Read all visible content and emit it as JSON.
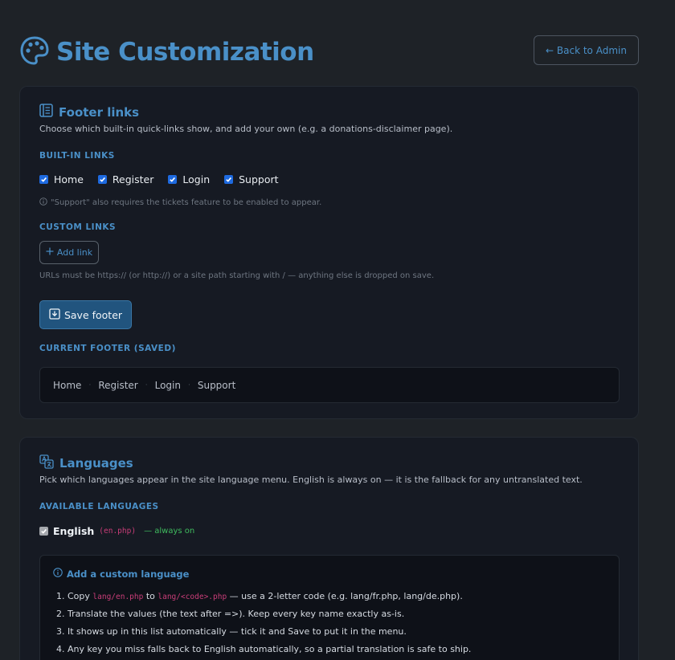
{
  "page": {
    "title": "Site Customization",
    "back_label": "← Back to Admin"
  },
  "footer_section": {
    "title": "Footer links",
    "description": "Choose which built-in quick-links show, and add your own (e.g. a donations-disclaimer page).",
    "builtin_label": "BUILT-IN LINKS",
    "builtin_links": [
      {
        "label": "Home",
        "checked": true
      },
      {
        "label": "Register",
        "checked": true
      },
      {
        "label": "Login",
        "checked": true
      },
      {
        "label": "Support",
        "checked": true
      }
    ],
    "support_note": "\"Support\" also requires the tickets feature to be enabled to appear.",
    "custom_label": "CUSTOM LINKS",
    "add_link_label": "Add link",
    "url_note": "URLs must be https:// (or http://) or a site path starting with / — anything else is dropped on save.",
    "save_label": "Save footer",
    "current_label": "CURRENT FOOTER (SAVED)",
    "current_links": [
      "Home",
      "Register",
      "Login",
      "Support"
    ],
    "separator": "·"
  },
  "languages_section": {
    "title": "Languages",
    "description": "Pick which languages appear in the site language menu. English is always on — it is the fallback for any untranslated text.",
    "available_label": "AVAILABLE LANGUAGES",
    "english": {
      "name": "English",
      "file": "(en.php)",
      "tag": "— always on"
    },
    "custom_box": {
      "title": "Add a custom language",
      "step1": {
        "num": "1.",
        "pre": "Copy",
        "code1": "lang/en.php",
        "mid": "to",
        "code2": "lang/<code>.php",
        "post": "— use a 2-letter code (e.g. lang/fr.php, lang/de.php)."
      },
      "step2": "2. Translate the values (the text after =>). Keep every key name exactly as-is.",
      "step3": "3. It shows up in this list automatically — tick it and Save to put it in the menu.",
      "step4": "4. Any key you miss falls back to English automatically, so a partial translation is safe to ship."
    }
  },
  "colors": {
    "accent": "#4a90c8",
    "background": "#1e2227",
    "card": "#161a23",
    "checkbox": "#1e6ae0",
    "code": "#c93d78",
    "success": "#3fbb5e"
  }
}
